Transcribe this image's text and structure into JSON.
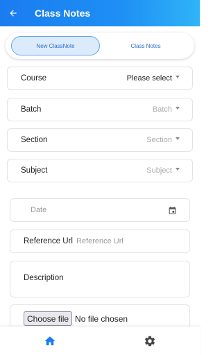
{
  "header": {
    "title": "Class Notes",
    "back_icon": "arrow-left-icon"
  },
  "tabs": [
    {
      "label": "New ClassNote",
      "active": true
    },
    {
      "label": "Class Notes",
      "active": false
    }
  ],
  "form": {
    "course": {
      "label": "Course",
      "value": "Please select"
    },
    "batch": {
      "label": "Batch",
      "placeholder": "Batch"
    },
    "section": {
      "label": "Section",
      "placeholder": "Section"
    },
    "subject": {
      "label": "Subject",
      "placeholder": "Subject"
    },
    "date": {
      "placeholder": "Date",
      "icon": "calendar-icon"
    },
    "reference_url": {
      "label": "Reference Url",
      "placeholder": "Reference Url"
    },
    "description": {
      "label": "Description"
    },
    "file": {
      "button_label": "Choose file",
      "status": "No file chosen"
    }
  },
  "bottom_nav": [
    {
      "icon": "home-icon",
      "active": true
    },
    {
      "icon": "settings-icon",
      "active": false
    }
  ],
  "colors": {
    "primary": "#1a7cf0",
    "accent_light": "#dcebfc",
    "active_nav": "#1a7cf0",
    "inactive_nav": "#444444"
  }
}
